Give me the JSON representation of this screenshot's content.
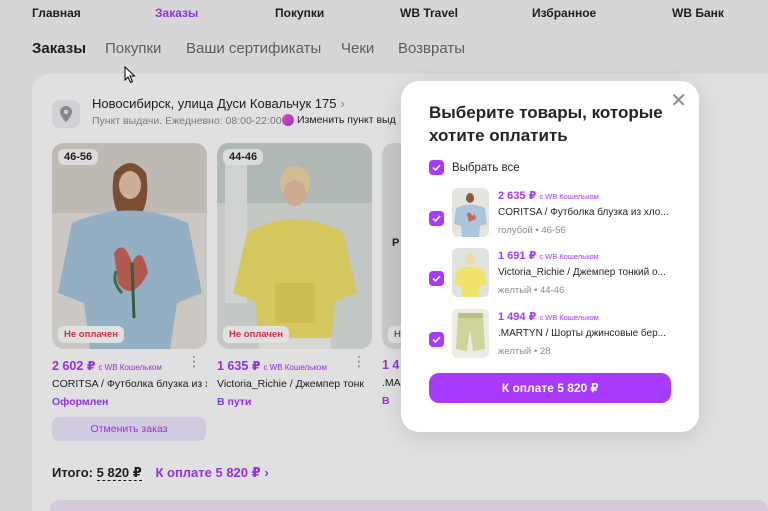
{
  "topnav": [
    {
      "label": "Главная",
      "active": false
    },
    {
      "label": "Заказы",
      "active": true
    },
    {
      "label": "Покупки",
      "active": false
    },
    {
      "label": "WB Travel",
      "active": false
    },
    {
      "label": "Избранное",
      "active": false
    },
    {
      "label": "WB Банк",
      "active": false
    }
  ],
  "subnav": [
    {
      "label": "Заказы",
      "active": true
    },
    {
      "label": "Покупки",
      "active": false
    },
    {
      "label": "Ваши сертификаты",
      "active": false
    },
    {
      "label": "Чеки",
      "active": false
    },
    {
      "label": "Возвраты",
      "active": false
    }
  ],
  "pickup": {
    "address": "Новосибирск, улица Дуси Ковальчук 175",
    "hours": "Пункт выдачи. Ежедневно: 08:00-22:00",
    "change_label": "Изменить пункт выд"
  },
  "products": [
    {
      "size": "46-56",
      "unpaid": "Не оплачен",
      "price": "2 602 ₽",
      "wallet": "с WB Кошельком",
      "title": "CORITSA / Футболка блузка из хло",
      "status": "Оформлен"
    },
    {
      "size": "44-46",
      "unpaid": "Не оплачен",
      "price": "1 635 ₽",
      "wallet": "с WB Кошельком",
      "title": "Victoria_Richie / Джемпер тонк",
      "status": "В пути"
    },
    {
      "size": "Р",
      "unpaid": "Не оплачен",
      "price": "1 4",
      "wallet": "",
      "title": ".MA",
      "status": "В"
    }
  ],
  "cancel_label": "Отменить заказ",
  "total": {
    "label": "Итого:",
    "amount": "5 820 ₽",
    "pay_label": "К оплате 5 820 ₽",
    "chevron": "›"
  },
  "modal": {
    "title": "Выберите товары, которые хотите оплатить",
    "select_all": "Выбрать все",
    "items": [
      {
        "price": "2 635 ₽",
        "wallet": "с WB Кошельком",
        "title": "CORITSA / Футболка блузка из хло...",
        "meta": "голубой • 46-56"
      },
      {
        "price": "1 691 ₽",
        "wallet": "с WB Кошельком",
        "title": "Victoria_Richie / Джемпер тонкий о...",
        "meta": "желтый • 44-46"
      },
      {
        "price": "1 494 ₽",
        "wallet": "с WB Кошельком",
        "title": ".MARTYN / Шорты джинсовые бер...",
        "meta": "желтый • 28"
      }
    ],
    "pay_button": "К оплате 5 820 ₽"
  },
  "colors": {
    "accent": "#a73afd",
    "error": "#f2374d"
  }
}
